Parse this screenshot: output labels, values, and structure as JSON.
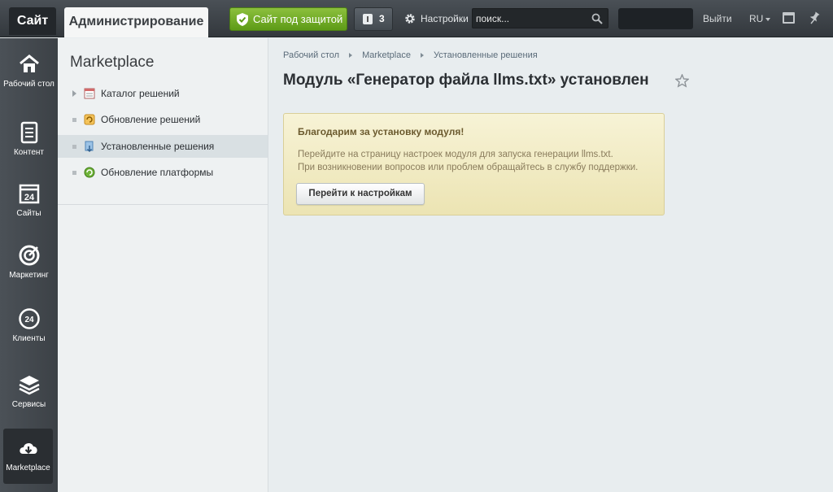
{
  "topbar": {
    "site_tab": "Сайт",
    "admin_tab": "Администрирование",
    "protect_button": "Сайт под защитой",
    "notifications_count": "3",
    "settings_label": "Настройки",
    "search_placeholder": "поиск...",
    "logout_label": "Выйти",
    "lang_label": "RU"
  },
  "menu": {
    "items": [
      {
        "label": "Рабочий стол",
        "icon": "home-icon"
      },
      {
        "label": "Контент",
        "icon": "document-icon"
      },
      {
        "label": "Сайты",
        "icon": "calendar-24-icon"
      },
      {
        "label": "Маркетинг",
        "icon": "target-icon"
      },
      {
        "label": "Клиенты",
        "icon": "clients-24-icon"
      },
      {
        "label": "Сервисы",
        "icon": "layers-icon"
      },
      {
        "label": "Marketplace",
        "icon": "cloud-download-icon"
      }
    ]
  },
  "panel": {
    "title": "Marketplace",
    "items": [
      {
        "label": "Каталог решений",
        "icon": "catalog-icon"
      },
      {
        "label": "Обновление решений",
        "icon": "update-icon"
      },
      {
        "label": "Установленные решения",
        "icon": "installed-icon"
      },
      {
        "label": "Обновление платформы",
        "icon": "platform-update-icon"
      }
    ]
  },
  "breadcrumbs": [
    "Рабочий стол",
    "Marketplace",
    "Установленные решения"
  ],
  "page": {
    "title": "Модуль «Генератор файла llms.txt» установлен"
  },
  "notice": {
    "title": "Благодарим за установку модуля!",
    "line1": "Перейдите на страницу настроек модуля для запуска генерации llms.txt.",
    "line2": "При возникновении вопросов или проблем обращайтесь в службу поддержки.",
    "button": "Перейти к настройкам"
  },
  "colors": {
    "protect_green": "#6aa620",
    "notice_bg": "#f2ecc6"
  }
}
